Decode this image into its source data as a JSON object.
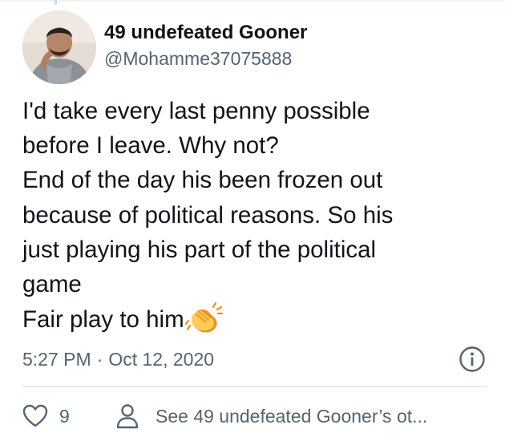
{
  "author": {
    "display_name": "49 undefeated Gooner",
    "handle": "@Mohamme37075888",
    "avatar_icon": "profile-photo"
  },
  "tweet": {
    "lines": [
      "I'd take every last penny possible",
      "before I leave. Why not?",
      "End of the day his been frozen out",
      "because of political reasons. So his",
      "just playing his part of the political",
      "game",
      "Fair play to him"
    ],
    "emoji": "clapping-hands-emoji"
  },
  "meta": {
    "time": "5:27 PM",
    "separator": "·",
    "date": "Oct 12, 2020",
    "info_icon": "info-icon"
  },
  "actions": {
    "like_icon": "heart-icon",
    "like_count": "9",
    "profile_icon": "person-icon",
    "profile_label": "See 49 undefeated Gooner’s ot..."
  },
  "colors": {
    "text_primary": "#0f1419",
    "text_secondary": "#536471",
    "divider": "#cfd9de",
    "clap_yellow": "#fdcb58",
    "clap_orange": "#f4900c"
  }
}
